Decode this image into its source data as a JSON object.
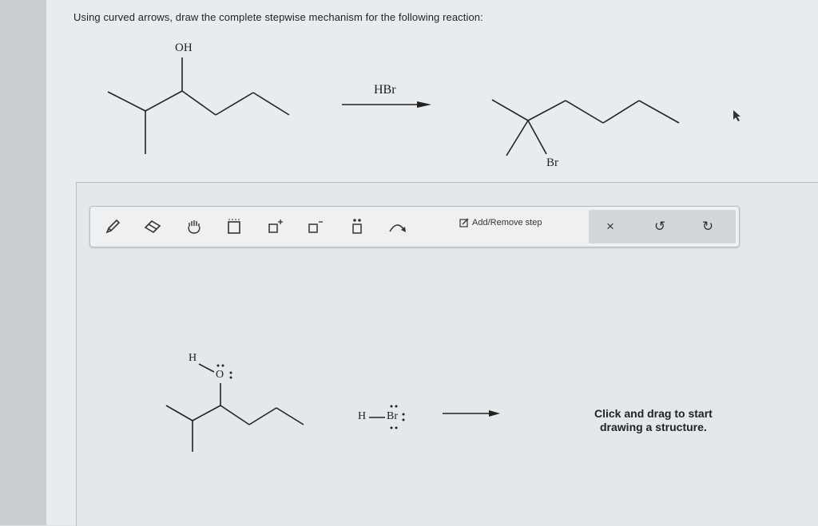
{
  "question": "Using curved arrows, draw the complete stepwise mechanism for the following reaction:",
  "reaction": {
    "reactant_label": "OH",
    "reagent": "HBr",
    "product_label": "Br"
  },
  "toolbar": {
    "tools": [
      {
        "name": "pencil-icon"
      },
      {
        "name": "eraser-icon"
      },
      {
        "name": "hand-icon"
      },
      {
        "name": "select-box-icon"
      },
      {
        "name": "positive-charge-icon"
      },
      {
        "name": "negative-charge-icon"
      },
      {
        "name": "lone-pair-icon"
      },
      {
        "name": "curved-arrow-icon"
      }
    ],
    "add_remove_step": "Add/Remove step",
    "clear_label": "×",
    "undo_label": "↺",
    "redo_label": "↻"
  },
  "workspace": {
    "atoms": {
      "h_on_o": "H",
      "o": "O",
      "h_hbr": "H",
      "br": "Br"
    },
    "hint_line1": "Click and drag to start",
    "hint_line2": "drawing a structure."
  },
  "colors": {
    "ink": "#222222",
    "toolbar_bg": "#eef0f2",
    "group_bg": "#d4d7da"
  }
}
